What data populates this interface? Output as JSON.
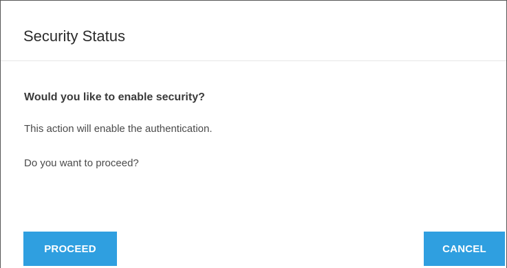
{
  "dialog": {
    "title": "Security Status",
    "question": "Would you like to enable security?",
    "message_line1": "This action will enable the authentication.",
    "message_line2": "Do you want to proceed?",
    "proceed_label": "PROCEED",
    "cancel_label": "CANCEL"
  },
  "colors": {
    "button_bg": "#2f9fe0",
    "button_text": "#ffffff",
    "title_text": "#2b2b2b"
  }
}
